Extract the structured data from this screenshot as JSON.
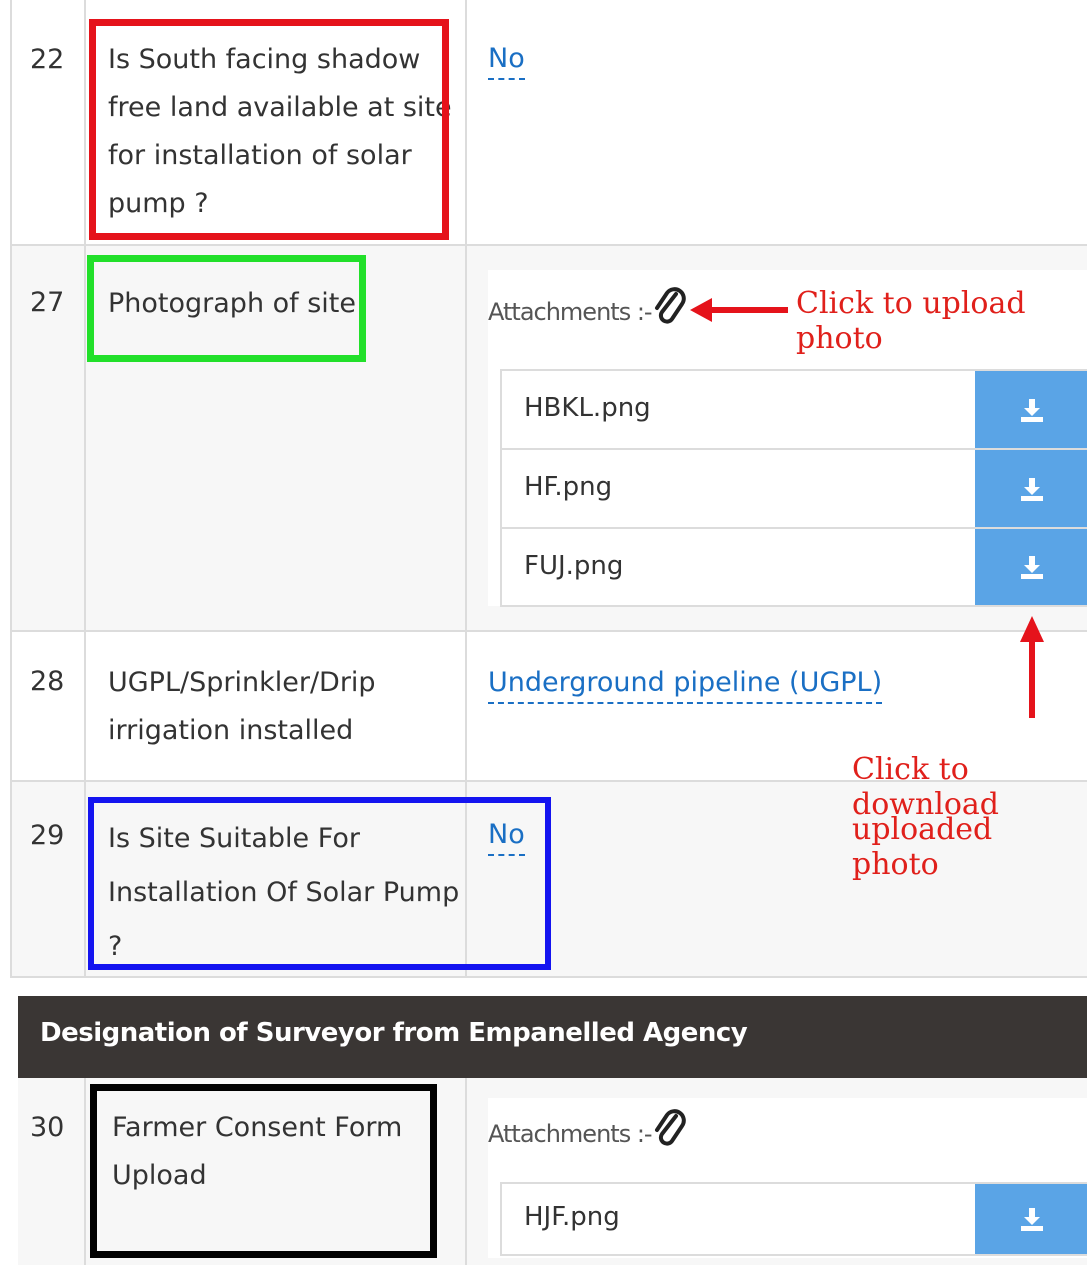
{
  "rows": [
    {
      "num": "22",
      "question": [
        "Is South facing shadow",
        "free land available at site",
        "for installation of solar",
        "pump ?"
      ],
      "answer": "No"
    },
    {
      "num": "27",
      "question": [
        "Photograph of site"
      ],
      "attachments_label": "Attachments :-",
      "files": [
        "HBKL.png",
        "HF.png",
        "FUJ.png"
      ]
    },
    {
      "num": "28",
      "question": [
        "UGPL/Sprinkler/Drip",
        "irrigation installed"
      ],
      "answer": "Underground pipeline (UGPL)"
    },
    {
      "num": "29",
      "question": [
        "Is Site Suitable For",
        "Installation Of Solar Pump",
        "?"
      ],
      "answer": "No"
    }
  ],
  "section": {
    "title": "Designation of Surveyor from Empanelled Agency"
  },
  "row30": {
    "num": "30",
    "question": [
      "Farmer Consent Form",
      "Upload"
    ],
    "attachments_label": "Attachments :-",
    "files": [
      "HJF.png"
    ]
  },
  "annotations": {
    "upload": "Click to upload photo",
    "download_line1": "Click to download",
    "download_line2": "uploaded photo"
  },
  "colors": {
    "highlight_red": "#e5131b",
    "highlight_green": "#22e02a",
    "highlight_blue": "#1414f0",
    "highlight_black": "#000000",
    "link_blue": "#1a6fc4",
    "download_button": "#5aa4e6",
    "section_bar": "#3a3634",
    "annotation_red": "#e0201b"
  },
  "icons": {
    "attachment": "paperclip-icon",
    "download": "download-icon"
  }
}
